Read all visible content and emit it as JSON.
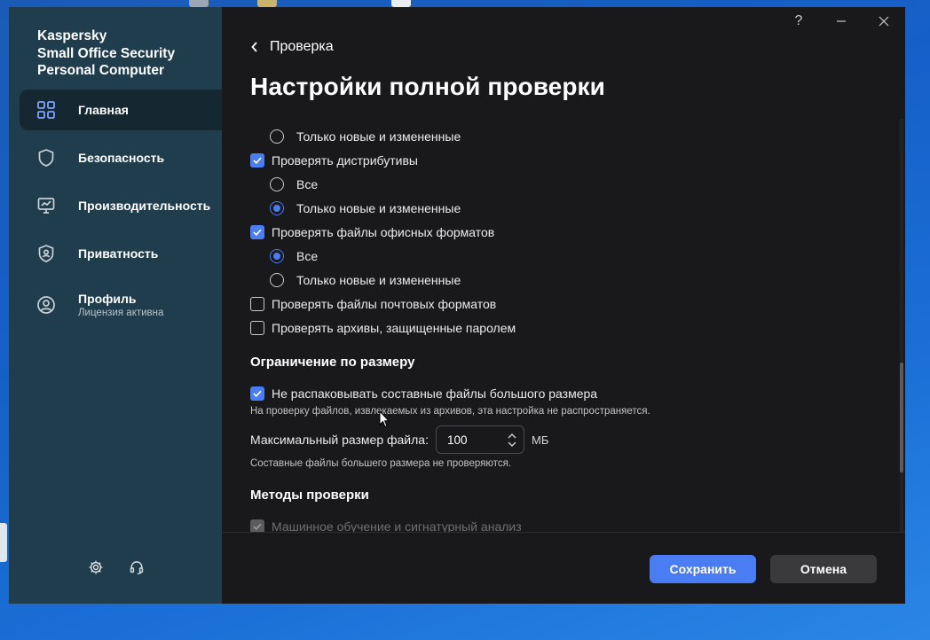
{
  "app": {
    "brand_line1": "Kaspersky",
    "brand_line2": "Small Office Security",
    "brand_line3": "Personal Computer"
  },
  "window_controls": {
    "help": "?"
  },
  "nav": {
    "items": [
      {
        "label": "Главная",
        "icon": "dashboard-icon",
        "active": true
      },
      {
        "label": "Безопасность",
        "icon": "shield-icon"
      },
      {
        "label": "Производительность",
        "icon": "monitor-icon"
      },
      {
        "label": "Приватность",
        "icon": "privacy-shield-icon"
      },
      {
        "label": "Профиль",
        "sub": "Лицензия активна",
        "icon": "user-icon"
      }
    ],
    "bottom_icons": [
      "gear-icon",
      "headset-icon"
    ]
  },
  "header": {
    "back_label": "Проверка",
    "title": "Настройки полной проверки"
  },
  "options": {
    "r0": {
      "label": "Только новые и измененные",
      "checked": false
    },
    "c1": {
      "label": "Проверять дистрибутивы",
      "checked": true
    },
    "r1a": {
      "label": "Все",
      "checked": false
    },
    "r1b": {
      "label": "Только новые и измененные",
      "checked": true
    },
    "c2": {
      "label": "Проверять файлы офисных форматов",
      "checked": true
    },
    "r2a": {
      "label": "Все",
      "checked": true
    },
    "r2b": {
      "label": "Только новые и измененные",
      "checked": false
    },
    "c3": {
      "label": "Проверять файлы почтовых форматов",
      "checked": false
    },
    "c4": {
      "label": "Проверять архивы, защищенные паролем",
      "checked": false
    }
  },
  "size_limit": {
    "section_title": "Ограничение по размеру",
    "checkbox_label": "Не распаковывать составные файлы большого размера",
    "checked": true,
    "note1": "На проверку файлов, извлекаемых из архивов, эта настройка не распространяется.",
    "max_label": "Максимальный размер файла:",
    "max_value": "100",
    "unit": "МБ",
    "note2": "Составные файлы большего размера не проверяются."
  },
  "methods": {
    "section_title": "Методы проверки",
    "ml_label": "Машинное обучение и сигнатурный анализ",
    "ml_checked": true,
    "ml_disabled": true
  },
  "footer": {
    "save_label": "Сохранить",
    "cancel_label": "Отмена"
  },
  "colors": {
    "accent": "#4a7cf3",
    "sidebar": "#1f3d4c",
    "window": "#19191b"
  }
}
